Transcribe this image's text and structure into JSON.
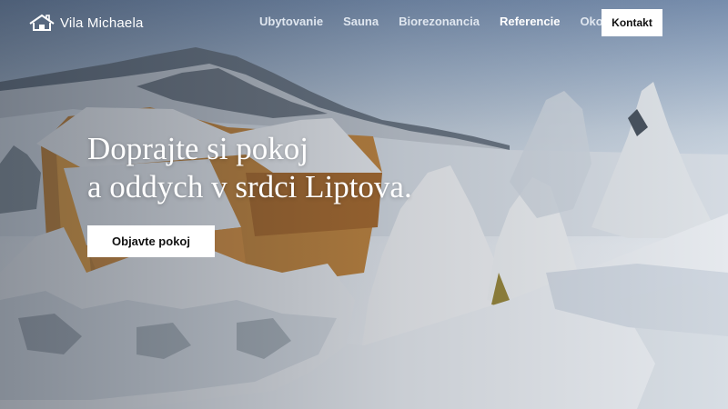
{
  "brand": {
    "name": "Vila Michaela",
    "icon": "house-logo-icon"
  },
  "nav": {
    "items": [
      {
        "label": "Ubytovanie",
        "active": false
      },
      {
        "label": "Sauna",
        "active": false
      },
      {
        "label": "Biorezonancia",
        "active": false
      },
      {
        "label": "Referencie",
        "active": true
      },
      {
        "label": "Okolie",
        "active": false
      }
    ],
    "contact_label": "Kontakt"
  },
  "hero": {
    "headline_line1": "Doprajte si pokoj",
    "headline_line2": "a oddych v srdci Liptova.",
    "cta_label": "Objavte pokoj"
  },
  "colors": {
    "text": "#ffffff",
    "button_bg": "#ffffff",
    "button_text": "#111111"
  }
}
